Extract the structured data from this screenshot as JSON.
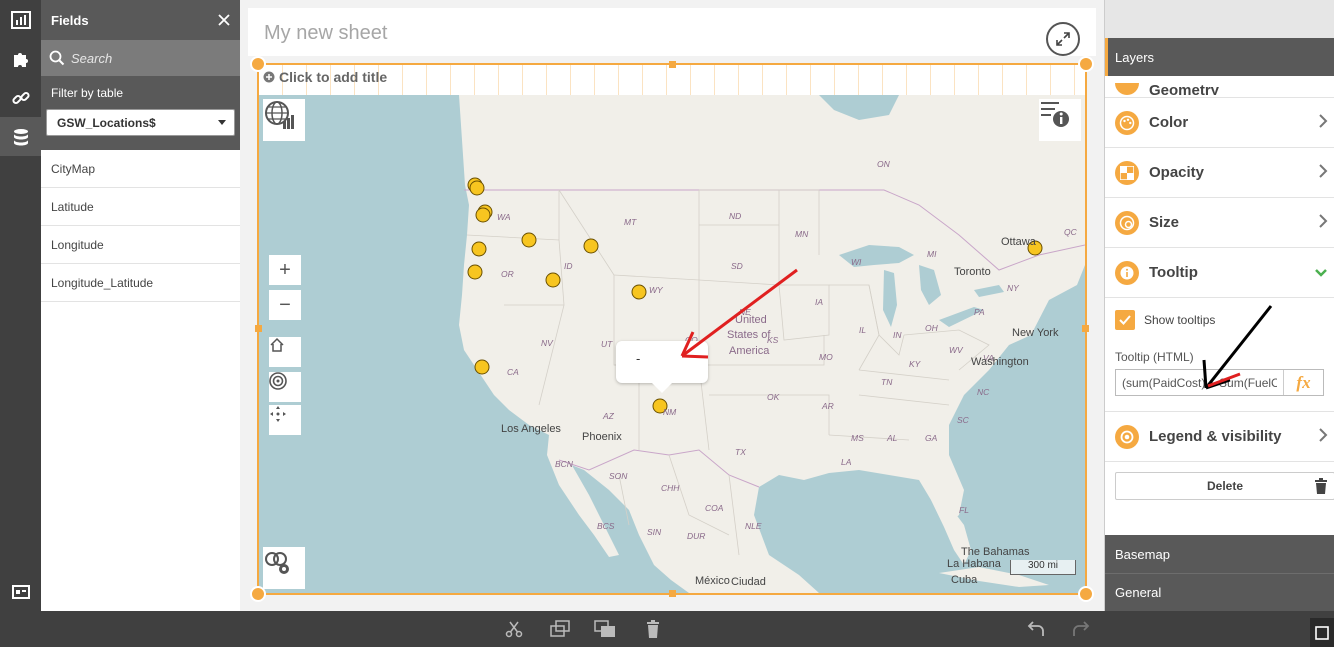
{
  "fields_panel": {
    "title": "Fields",
    "search_placeholder": "Search",
    "filter_label": "Filter by table",
    "table_selected": "GSW_Locations$",
    "items": [
      "CityMap",
      "Latitude",
      "Longitude",
      "Longitude_Latitude"
    ]
  },
  "sheet": {
    "title": "My new sheet",
    "add_title": "Click to add title"
  },
  "map": {
    "labels": {
      "ON": "ON",
      "WA": "WA",
      "MT": "MT",
      "ND": "ND",
      "MN": "MN",
      "OR": "OR",
      "ID": "ID",
      "SD": "SD",
      "WY": "WY",
      "WI": "WI",
      "MI": "MI",
      "IA": "IA",
      "NE": "NE",
      "NV": "NV",
      "UT": "UT",
      "CO": "CO",
      "KS": "KS",
      "MO": "MO",
      "IL": "IL",
      "IN": "IN",
      "OH": "OH",
      "PA": "PA",
      "NY": "NY",
      "CA": "CA",
      "AZ": "AZ",
      "NM": "NM",
      "OK": "OK",
      "AR": "AR",
      "TN": "TN",
      "KY": "KY",
      "WV": "WV",
      "VA": "VA",
      "NC": "NC",
      "SC": "SC",
      "GA": "GA",
      "AL": "AL",
      "MS": "MS",
      "LA": "LA",
      "TX": "TX",
      "FL": "FL",
      "BCN": "BCN",
      "SON": "SON",
      "CHH": "CHH",
      "BCS": "BCS",
      "COA": "COA",
      "NLE": "NLE",
      "DUR": "DUR",
      "SIN": "SIN",
      "QC": "QC"
    },
    "cities": {
      "ottawa": "Ottawa",
      "toronto": "Toronto",
      "new_york": "New York",
      "washington": "Washington",
      "los_angeles": "Los Angeles",
      "phoenix": "Phoenix",
      "usa_line1": "United",
      "usa_line2": "States of",
      "usa_line3": "America",
      "mexico": "México",
      "ciudad": "Ciudad",
      "bahamas": "The Bahamas",
      "la_habana": "La Habana",
      "cuba": "Cuba"
    },
    "tooltip_text": "-",
    "scale_label": "300 mi",
    "zoom_in": "+",
    "zoom_out": "−"
  },
  "props_panel": {
    "layers_label": "Layers",
    "geometry_label": "Geometry",
    "color_label": "Color",
    "opacity_label": "Opacity",
    "size_label": "Size",
    "tooltip_label": "Tooltip",
    "show_tooltips_label": "Show tooltips",
    "tooltip_html_label": "Tooltip (HTML)",
    "tooltip_html_value": "(sum(PaidCost) + Sum(FuelC",
    "fx_label": "fx",
    "legend_label": "Legend & visibility",
    "delete_label": "Delete",
    "basemap_label": "Basemap",
    "general_label": "General"
  },
  "colors": {
    "accent": "#f5a941",
    "dark": "#404040",
    "arrow_red": "#e02020",
    "arrow_black": "#000000",
    "point_fill": "#f7c520"
  }
}
